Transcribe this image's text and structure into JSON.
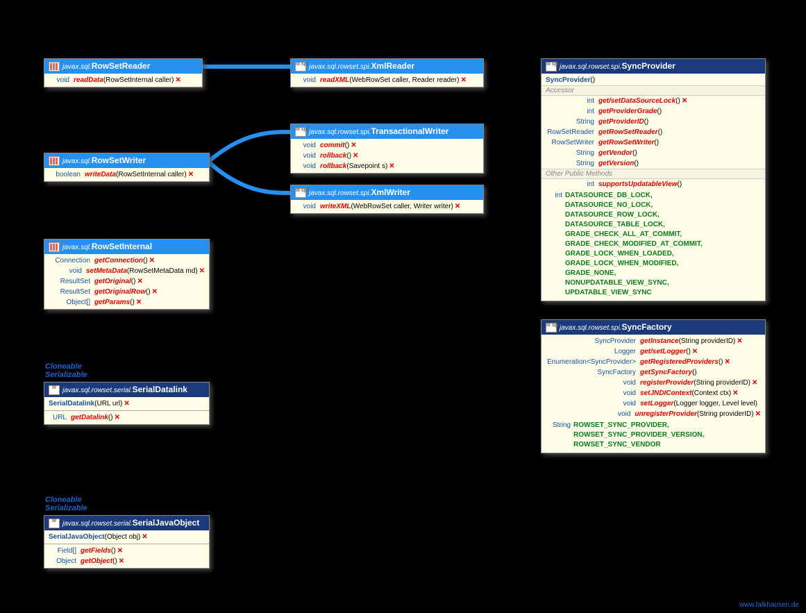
{
  "url_label": "www.falkhausen.de",
  "impl": {
    "cloneable": "Cloneable",
    "serializable": "Serializable"
  },
  "rowSetReader": {
    "pkg": "javax.sql.",
    "cls": "RowSetReader",
    "m1_ret": "void",
    "m1_name": "readData",
    "m1_sig": " (RowSetInternal caller) "
  },
  "xmlReader": {
    "pkg": "javax.sql.rowset.spi.",
    "cls": "XmlReader",
    "m1_ret": "void",
    "m1_name": "readXML",
    "m1_sig": " (WebRowSet caller, Reader reader) "
  },
  "rowSetWriter": {
    "pkg": "javax.sql.",
    "cls": "RowSetWriter",
    "m1_ret": "boolean",
    "m1_name": "writeData",
    "m1_sig": " (RowSetInternal caller) "
  },
  "txWriter": {
    "pkg": "javax.sql.rowset.spi.",
    "cls": "TransactionalWriter",
    "m1_ret": "void",
    "m1_name": "commit",
    "m1_sig": " () ",
    "m2_ret": "void",
    "m2_name": "rollback",
    "m2_sig": " () ",
    "m3_ret": "void",
    "m3_name": "rollback",
    "m3_sig": " (Savepoint s) "
  },
  "xmlWriter": {
    "pkg": "javax.sql.rowset.spi.",
    "cls": "XmlWriter",
    "m1_ret": "void",
    "m1_name": "writeXML",
    "m1_sig": " (WebRowSet caller, Writer writer) "
  },
  "rowSetInternal": {
    "pkg": "javax.sql.",
    "cls": "RowSetInternal",
    "m1_ret": "Connection",
    "m1_name": "getConnection",
    "m1_sig": " () ",
    "m2_ret": "void",
    "m2_name": "setMetaData",
    "m2_sig": " (RowSetMetaData md) ",
    "m3_ret": "ResultSet",
    "m3_name": "getOriginal",
    "m3_sig": " () ",
    "m4_ret": "ResultSet",
    "m4_name": "getOriginalRow",
    "m4_sig": " () ",
    "m5_ret": "Object[]",
    "m5_name": "getParams",
    "m5_sig": " () "
  },
  "serialDatalink": {
    "pkg": "javax.sql.rowset.serial.",
    "cls": "SerialDatalink",
    "c_name": "SerialDatalink",
    "c_sig": " (URL url) ",
    "m1_ret": "URL",
    "m1_name": "getDatalink",
    "m1_sig": " () "
  },
  "serialJavaObject": {
    "pkg": "javax.sql.rowset.serial.",
    "cls": "SerialJavaObject",
    "c_name": "SerialJavaObject",
    "c_sig": " (Object obj) ",
    "m1_ret": "Field[]",
    "m1_name": "getFields",
    "m1_sig": " () ",
    "m2_ret": "Object",
    "m2_name": "getObject",
    "m2_sig": " () "
  },
  "syncProvider": {
    "pkg": "javax.sql.rowset.spi.",
    "cls": "SyncProvider",
    "c_name": "SyncProvider",
    "c_sig": " ()",
    "sect1": "Accessor",
    "sect2": "Other Public Methods",
    "a1_ret": "int",
    "a1_name": "get/setDataSourceLock",
    "a1_sig": " () ",
    "a2_ret": "int",
    "a2_name": "getProviderGrade",
    "a2_sig": " ()",
    "a3_ret": "String",
    "a3_name": "getProviderID",
    "a3_sig": " ()",
    "a4_ret": "RowSetReader",
    "a4_name": "getRowSetReader",
    "a4_sig": " ()",
    "a5_ret": "RowSetWriter",
    "a5_name": "getRowSetWriter",
    "a5_sig": " ()",
    "a6_ret": "String",
    "a6_name": "getVendor",
    "a6_sig": " ()",
    "a7_ret": "String",
    "a7_name": "getVersion",
    "a7_sig": " ()",
    "o1_ret": "int",
    "o1_name": "supportsUpdatableView",
    "o1_sig": " ()",
    "const_type": "int",
    "c1": "DATASOURCE_DB_LOCK,",
    "c2": "DATASOURCE_NO_LOCK,",
    "c3": "DATASOURCE_ROW_LOCK,",
    "c4": "DATASOURCE_TABLE_LOCK,",
    "c5": "GRADE_CHECK_ALL_AT_COMMIT,",
    "c6": "GRADE_CHECK_MODIFIED_AT_COMMIT,",
    "c7": "GRADE_LOCK_WHEN_LOADED,",
    "c8": "GRADE_LOCK_WHEN_MODIFIED,",
    "c9": "GRADE_NONE,",
    "c10": "NONUPDATABLE_VIEW_SYNC,",
    "c11": "UPDATABLE_VIEW_SYNC"
  },
  "syncFactory": {
    "pkg": "javax.sql.rowset.spi.",
    "cls": "SyncFactory",
    "m1_ret": "SyncProvider",
    "m1_name": "getInstance",
    "m1_sig": " (String providerID) ",
    "m2_ret": "Logger",
    "m2_name": "get/setLogger",
    "m2_sig": " () ",
    "m3_ret": "Enumeration<SyncProvider>",
    "m3_name": "getRegisteredProviders",
    "m3_sig": " () ",
    "m4_ret": "SyncFactory",
    "m4_name": "getSyncFactory",
    "m4_sig": " ()",
    "m5_ret": "void",
    "m5_name": "registerProvider",
    "m5_sig": " (String providerID) ",
    "m6_ret": "void",
    "m6_name": "setJNDIContext",
    "m6_sig": " (Context ctx) ",
    "m7_ret": "void",
    "m7_name": "setLogger",
    "m7_sig": " (Logger logger, Level level)",
    "m8_ret": "void",
    "m8_name": "unregisterProvider",
    "m8_sig": " (String providerID) ",
    "const_type": "String",
    "c1": "ROWSET_SYNC_PROVIDER,",
    "c2": "ROWSET_SYNC_PROVIDER_VERSION,",
    "c3": "ROWSET_SYNC_VENDOR"
  },
  "spi_icon_text": "III\nspi"
}
